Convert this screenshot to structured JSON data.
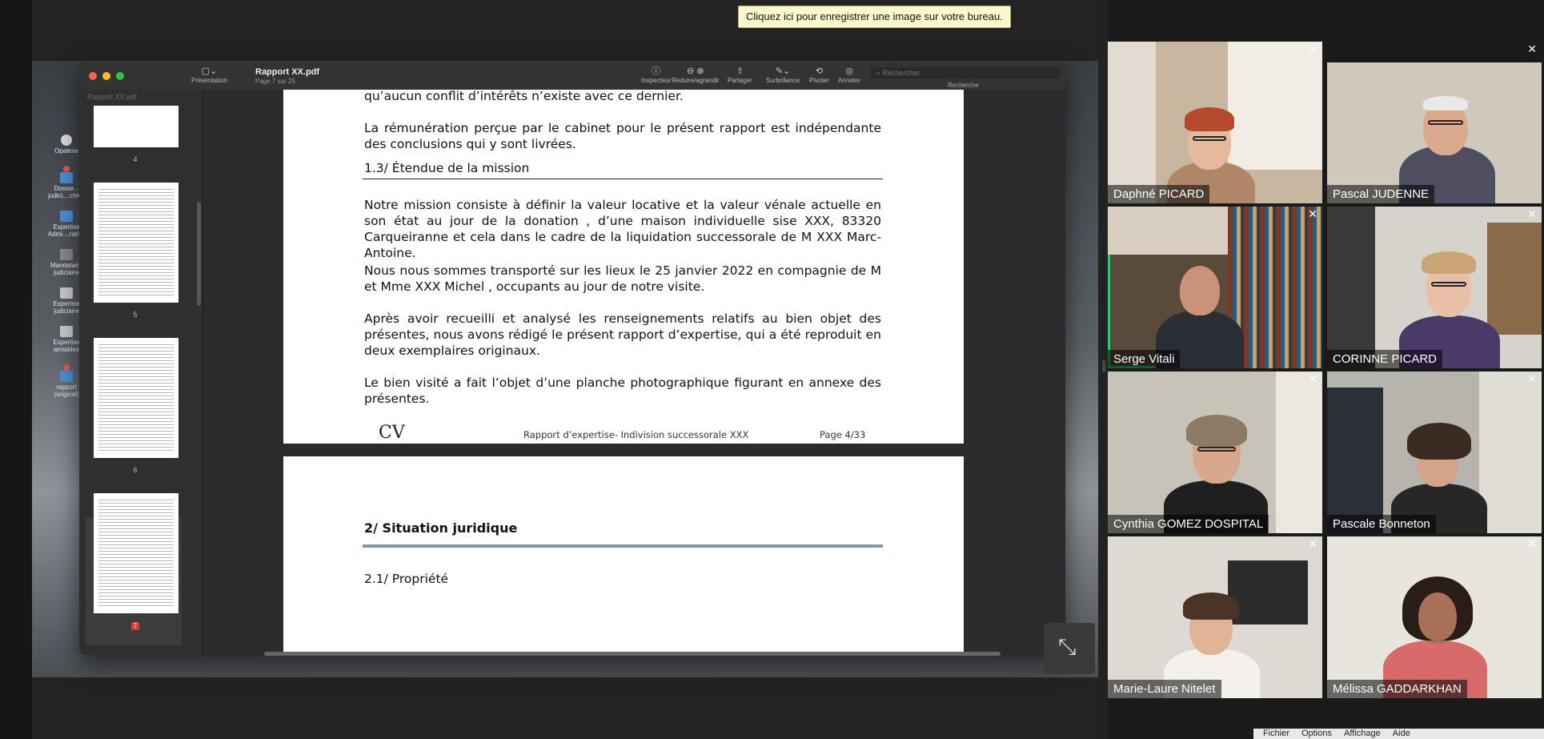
{
  "tooltip": "Cliquez ici pour enregistrer une image sur votre bureau.",
  "desktop_icons": [
    {
      "label": "Opalexe",
      "icon": "app-icon"
    },
    {
      "label": "Dossie... judici....chive",
      "icon": "folder-icon"
    },
    {
      "label": "Expertise Admi....rative",
      "icon": "folder-icon"
    },
    {
      "label": "Mandataire judiciaire",
      "icon": "drive-icon"
    },
    {
      "label": "Expertise judiciaire",
      "icon": "doc-icon"
    },
    {
      "label": "Expertise amiables",
      "icon": "doc-icon"
    },
    {
      "label": "rapport (original)",
      "icon": "folder-icon"
    }
  ],
  "window": {
    "title": "Rapport XX.pdf",
    "subtitle": "Page 7 sur 25",
    "sidebar_label": "Présentation",
    "sidebar_title": "Rapport XX.pdf",
    "toolbar": [
      {
        "label": "Inspecteur",
        "icon": "info-icon"
      },
      {
        "label": "Réduire/agrandir",
        "icon": "zoom-icon"
      },
      {
        "label": "Partager",
        "icon": "share-icon"
      },
      {
        "label": "Surbrillance",
        "icon": "highlight-icon"
      },
      {
        "label": "Pivoter",
        "icon": "rotate-icon"
      },
      {
        "label": "Annoter",
        "icon": "annotate-icon"
      }
    ],
    "search_placeholder": "Rechercher",
    "search_label": "Recherche",
    "thumbnails": [
      {
        "num": "4"
      },
      {
        "num": "5"
      },
      {
        "num": "6"
      },
      {
        "num": "7",
        "selected": true
      }
    ]
  },
  "document": {
    "top_line": "qu’aucun conflit d’intérêts n’existe avec ce dernier.",
    "p_remuneration": "La rémunération perçue par le cabinet pour le présent rapport est indépendante des conclusions qui y sont livrées.",
    "h_etendue": "1.3/  Étendue de la mission",
    "p_mission": "Notre mission consiste à définir la valeur locative et la valeur vénale actuelle en son état au jour de la donation , d’une maison individuelle sise XXX, 83320 Carqueiranne et cela dans le cadre de la liquidation successorale de M XXX Marc-Antoine.",
    "p_transport": "Nous nous sommes transporté sur les lieux le 25  janvier 2022 en compagnie de M et Mme XXX Michel , occupants au jour de notre visite.",
    "p_recueil": "Après avoir recueilli et analysé les renseignements relatifs au bien objet des présentes, nous avons rédigé le présent rapport d’expertise, qui a été reproduit en deux exemplaires originaux.",
    "p_planche": "Le bien visité a fait l’objet d’une planche photographique figurant en annexe des présentes.",
    "footer_logo": "CV",
    "footer_text": "Rapport d’expertise- Indivision successorale XXX",
    "footer_page": "Page 4/33",
    "h_situation": "2/   Situation juridique",
    "h_propriete_partial": "2.1/  Propriété"
  },
  "participants": [
    {
      "name": "Daphné PICARD"
    },
    {
      "name": "Pascal JUDENNE"
    },
    {
      "name": "Serge Vitali",
      "active": true
    },
    {
      "name": "CORINNE PICARD"
    },
    {
      "name": "Cynthia GOMEZ DOSPITAL"
    },
    {
      "name": "Pascale Bonneton"
    },
    {
      "name": "Marie-Laure Nitelet"
    },
    {
      "name": "Mélissa GADDARKHAN"
    }
  ],
  "bottom_menu": [
    "Fichier",
    "Options",
    "Affichage",
    "Aide"
  ]
}
